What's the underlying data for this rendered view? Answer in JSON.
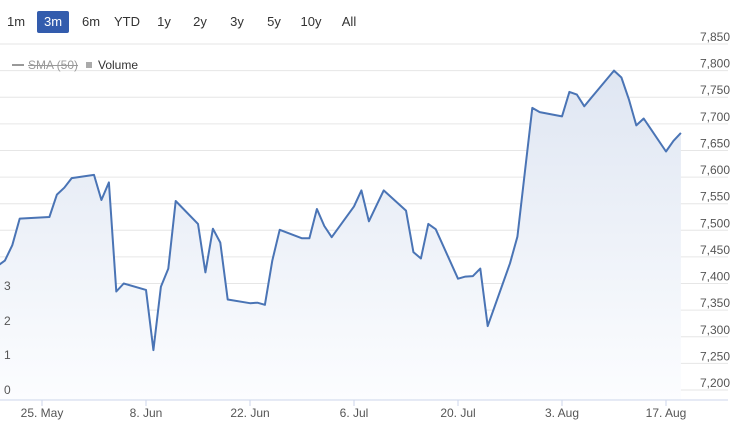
{
  "range_selector": {
    "buttons": [
      "1m",
      "3m",
      "6m",
      "YTD",
      "1y",
      "2y",
      "3y",
      "5y",
      "10y",
      "All"
    ],
    "active": "3m"
  },
  "legend": {
    "sma_label": "SMA (50)",
    "volume_label": "Volume"
  },
  "chart_data": {
    "type": "area",
    "x_tick_labels": [
      "25. May",
      "8. Jun",
      "22. Jun",
      "6. Jul",
      "20. Jul",
      "3. Aug",
      "17. Aug"
    ],
    "y_tick_labels": [
      "7,200",
      "7,250",
      "7,300",
      "7,350",
      "7,400",
      "7,450",
      "7,500",
      "7,550",
      "7,600",
      "7,650",
      "7,700",
      "7,750",
      "7,800",
      "7,850"
    ],
    "ylim": [
      7200,
      7850
    ],
    "volume_tick_labels": [
      "0",
      "1",
      "2",
      "3"
    ],
    "grid": true,
    "series": [
      {
        "x": [
          "2020-05-18",
          "2020-05-19",
          "2020-05-20",
          "2020-05-21",
          "2020-05-22",
          "2020-05-26",
          "2020-05-27",
          "2020-05-28",
          "2020-05-29",
          "2020-06-01",
          "2020-06-02",
          "2020-06-03",
          "2020-06-04",
          "2020-06-05",
          "2020-06-08",
          "2020-06-09",
          "2020-06-10",
          "2020-06-11",
          "2020-06-12",
          "2020-06-15",
          "2020-06-16",
          "2020-06-17",
          "2020-06-18",
          "2020-06-19",
          "2020-06-22",
          "2020-06-23",
          "2020-06-24",
          "2020-06-25",
          "2020-06-26",
          "2020-06-29",
          "2020-06-30",
          "2020-07-01",
          "2020-07-02",
          "2020-07-03",
          "2020-07-06",
          "2020-07-07",
          "2020-07-08",
          "2020-07-09",
          "2020-07-10",
          "2020-07-13",
          "2020-07-14",
          "2020-07-15",
          "2020-07-16",
          "2020-07-17",
          "2020-07-20",
          "2020-07-21",
          "2020-07-22",
          "2020-07-23",
          "2020-07-24",
          "2020-07-27",
          "2020-07-28",
          "2020-07-29",
          "2020-07-30",
          "2020-07-31",
          "2020-08-03",
          "2020-08-04",
          "2020-08-05",
          "2020-08-06",
          "2020-08-07",
          "2020-08-10",
          "2020-08-11",
          "2020-08-12",
          "2020-08-13",
          "2020-08-14",
          "2020-08-17",
          "2020-08-18",
          "2020-08-19"
        ],
        "values": [
          7384,
          7433,
          7443,
          7472,
          7522,
          7525,
          7567,
          7580,
          7598,
          7604,
          7557,
          7590,
          7385,
          7400,
          7388,
          7275,
          7394,
          7428,
          7555,
          7512,
          7421,
          7503,
          7477,
          7370,
          7363,
          7364,
          7360,
          7443,
          7501,
          7485,
          7485,
          7540,
          7508,
          7487,
          7545,
          7575,
          7517,
          7546,
          7575,
          7537,
          7459,
          7447,
          7512,
          7502,
          7409,
          7413,
          7414,
          7428,
          7320,
          7438,
          7488,
          7610,
          7730,
          7722,
          7714,
          7760,
          7755,
          7733,
          7750,
          7800,
          7787,
          7746,
          7697,
          7710,
          7648,
          7668,
          7683
        ]
      }
    ],
    "colors": {
      "line": "#4a74b5",
      "area_top": "#dfe6f2",
      "area_bottom": "#fcfdff",
      "grid": "#e6e6e6",
      "axis": "#ccd6eb"
    }
  }
}
